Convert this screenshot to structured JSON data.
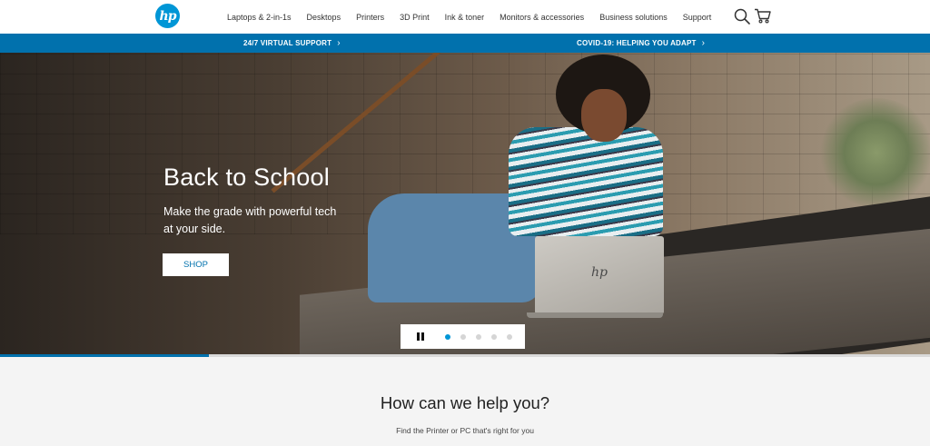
{
  "header": {
    "logo_text": "hp",
    "nav": [
      {
        "label": "Laptops & 2-in-1s"
      },
      {
        "label": "Desktops"
      },
      {
        "label": "Printers"
      },
      {
        "label": "3D Print"
      },
      {
        "label": "Ink & toner"
      },
      {
        "label": "Monitors & accessories"
      },
      {
        "label": "Business solutions"
      },
      {
        "label": "Support"
      }
    ],
    "icons": {
      "search": "search-icon",
      "cart": "cart-icon"
    }
  },
  "bluebar": {
    "left_link": "24/7 VIRTUAL SUPPORT",
    "right_link": "COVID-19: HELPING YOU ADAPT",
    "chevron": "›",
    "color": "#0171ad"
  },
  "hero": {
    "title": "Back to School",
    "subtitle": "Make the grade with powerful tech at your side.",
    "cta": "SHOP",
    "laptop_logo": "hp",
    "slides_total": 5,
    "active_slide": 1
  },
  "carousel_progress": 0.225,
  "help": {
    "title": "How can we help you?",
    "subtitle": "Find the Printer or PC that's right for you"
  },
  "colors": {
    "brand": "#0096d6",
    "accent": "#0171ad"
  }
}
